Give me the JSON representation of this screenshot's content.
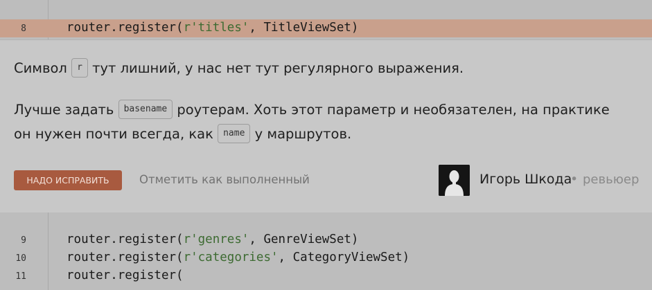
{
  "top_code": {
    "line_number": "8",
    "prefix": "router.register(",
    "string": "r'titles'",
    "suffix": ", TitleViewSet)"
  },
  "comment": {
    "para1_before": "Символ",
    "para1_chip": "r",
    "para1_after": "тут лишний, у нас нет тут регулярного выражения.",
    "para2_before": "Лучше задать",
    "para2_chip": "basename",
    "para2_after": "роутерам. Хоть этот параметр и необязателен, на практике",
    "para3_before": "он нужен почти всегда, как",
    "para3_chip": "name",
    "para3_after": "у маршрутов."
  },
  "actions": {
    "fix_label": "НАДО ИСПРАВИТЬ",
    "done_label": "Отметить как выполненный"
  },
  "reviewer": {
    "name": "Игорь Шкода",
    "separator": "•",
    "role": "ревьюер"
  },
  "bottom_code": [
    {
      "num": "9",
      "prefix": "router.register(",
      "string": "r'genres'",
      "suffix": ", GenreViewSet)"
    },
    {
      "num": "10",
      "prefix": "router.register(",
      "string": "r'categories'",
      "suffix": ", CategoryViewSet)"
    },
    {
      "num": "11",
      "prefix": "router.register(",
      "string": "",
      "suffix": ""
    }
  ]
}
